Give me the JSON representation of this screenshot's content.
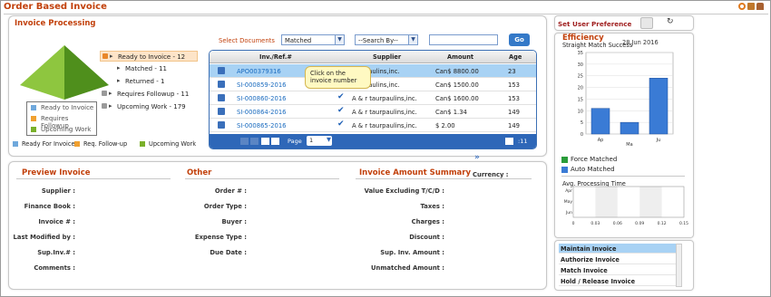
{
  "app": {
    "title": "Order Based Invoice"
  },
  "processing": {
    "title": "Invoice Processing",
    "tree": [
      {
        "label": "Ready to Invoice - 12",
        "indent": 0
      },
      {
        "label": "Matched - 11",
        "indent": 1
      },
      {
        "label": "Returned - 1",
        "indent": 1
      },
      {
        "label": "Requires Followup - 11",
        "indent": 0
      },
      {
        "label": "Upcoming Work - 179",
        "indent": 0
      }
    ],
    "pyramid_legend": [
      "Ready to Invoice",
      "Requires Followup",
      "Upcoming Work"
    ],
    "bottom_legend": [
      "Ready For Invoice",
      "Req. Follow-up",
      "Upcoming Work"
    ],
    "colors": {
      "ready": "#6fa8dc",
      "followup": "#f0a030",
      "upcoming": "#7ab02a"
    }
  },
  "filters": {
    "select_label": "Select Documents",
    "document_value": "Matched",
    "search_by": "--Search By--",
    "search_value": "",
    "go": "Go"
  },
  "table": {
    "headers": [
      "Inv./Ref.#",
      "Supplier",
      "Amount",
      "Age"
    ],
    "rows": [
      {
        "ref": "APO00379316",
        "supplier": "taurpaulins,inc.",
        "amount": "Can$ 8800.00",
        "age": "23",
        "check": ""
      },
      {
        "ref": "SI-000859-2016",
        "supplier": "taurpaulins,inc.",
        "amount": "Can$ 1500.00",
        "age": "153",
        "check": "✔"
      },
      {
        "ref": "SI-000860-2016",
        "supplier": "A & r taurpaulins,inc.",
        "amount": "Can$ 1600.00",
        "age": "153",
        "check": "✔"
      },
      {
        "ref": "SI-000864-2016",
        "supplier": "A & r taurpaulins,inc.",
        "amount": "Can$ 1.34",
        "age": "149",
        "check": "✔"
      },
      {
        "ref": "SI-000865-2016",
        "supplier": "A & r taurpaulins,inc.",
        "amount": "$ 2.00",
        "age": "149",
        "check": "✔"
      }
    ],
    "tooltip": "Click on the invoice number",
    "page_label": "Page",
    "page_value": "1",
    "count": ":11"
  },
  "preview": {
    "title": "Preview Invoice",
    "fields": [
      "Supplier :",
      "Finance Book :",
      "Invoice # :",
      "Last Modified by :",
      "Sup.Inv.# :",
      "Comments :"
    ]
  },
  "other": {
    "title": "Other",
    "fields": [
      "Order # :",
      "Order Type :",
      "Buyer :",
      "Expense Type :",
      "Due Date :"
    ]
  },
  "summary": {
    "title": "Invoice Amount Summary",
    "currency": "Currency :",
    "fields": [
      "Value Excluding T/C/D :",
      "Taxes :",
      "Charges :",
      "Discount :",
      "Sup. Inv. Amount :",
      "Unmatched Amount :"
    ]
  },
  "right": {
    "set_user_pref": "Set User Preference",
    "efficiency": "Efficiency",
    "date": "28 Jun 2016",
    "chart_title": "Straight Match Success",
    "legend_force": "Force Matched",
    "legend_auto": "Auto Matched",
    "proc_title": "Avg. Processing Time",
    "menu": [
      "Maintain Invoice",
      "Authorize Invoice",
      "Match Invoice",
      "Hold / Release Invoice"
    ]
  },
  "chart_data": [
    {
      "type": "bar",
      "title": "Straight Match Success",
      "categories": [
        "Ap",
        "Ma",
        "Ju"
      ],
      "values": [
        11,
        5,
        24
      ],
      "ylim": [
        0,
        35
      ],
      "yticks": [
        0,
        5,
        10,
        15,
        20,
        25,
        30,
        35
      ],
      "series": [
        {
          "name": "Auto Matched",
          "color": "#3a7bd5"
        }
      ]
    },
    {
      "type": "bar",
      "title": "Avg. Processing Time",
      "categories": [
        "Apr",
        "May",
        "Jun"
      ],
      "values": [
        0,
        0,
        0
      ],
      "xlim": [
        0,
        0.15
      ],
      "xticks": [
        "0",
        "0.03",
        "0.06",
        "0.09",
        "0.12",
        "0.15"
      ]
    }
  ]
}
